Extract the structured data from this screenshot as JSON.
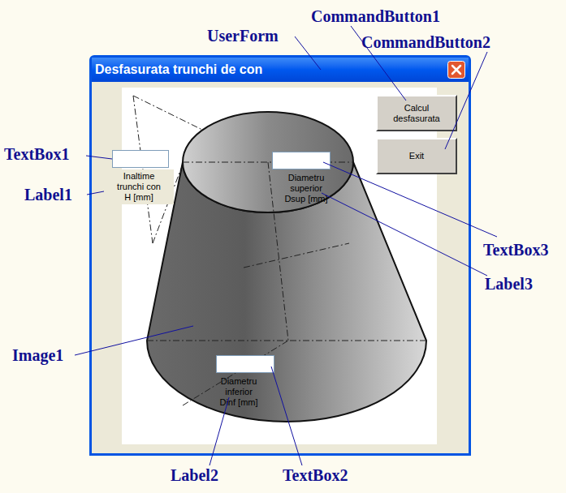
{
  "window": {
    "title": "Desfasurata trunchi de con"
  },
  "buttons": [
    {
      "lines": [
        "Calcul",
        "desfasurata"
      ]
    },
    {
      "lines": [
        "Exit"
      ]
    }
  ],
  "fields": [
    {
      "name": "height",
      "value": "",
      "label": [
        "Inaltime",
        "trunchi con",
        "H [mm]"
      ]
    },
    {
      "name": "top-diameter",
      "value": "",
      "label": [
        "Diametru",
        "superior",
        "Dsup [mm]"
      ]
    },
    {
      "name": "bottom-diameter",
      "value": "",
      "label": [
        "Diametru",
        "inferior",
        "Dinf [mm]"
      ]
    }
  ],
  "annotations": [
    "UserForm",
    "CommandButton1",
    "CommandButton2",
    "TextBox1",
    "Label1",
    "Image1",
    "TextBox3",
    "Label3",
    "Label2",
    "TextBox2"
  ]
}
